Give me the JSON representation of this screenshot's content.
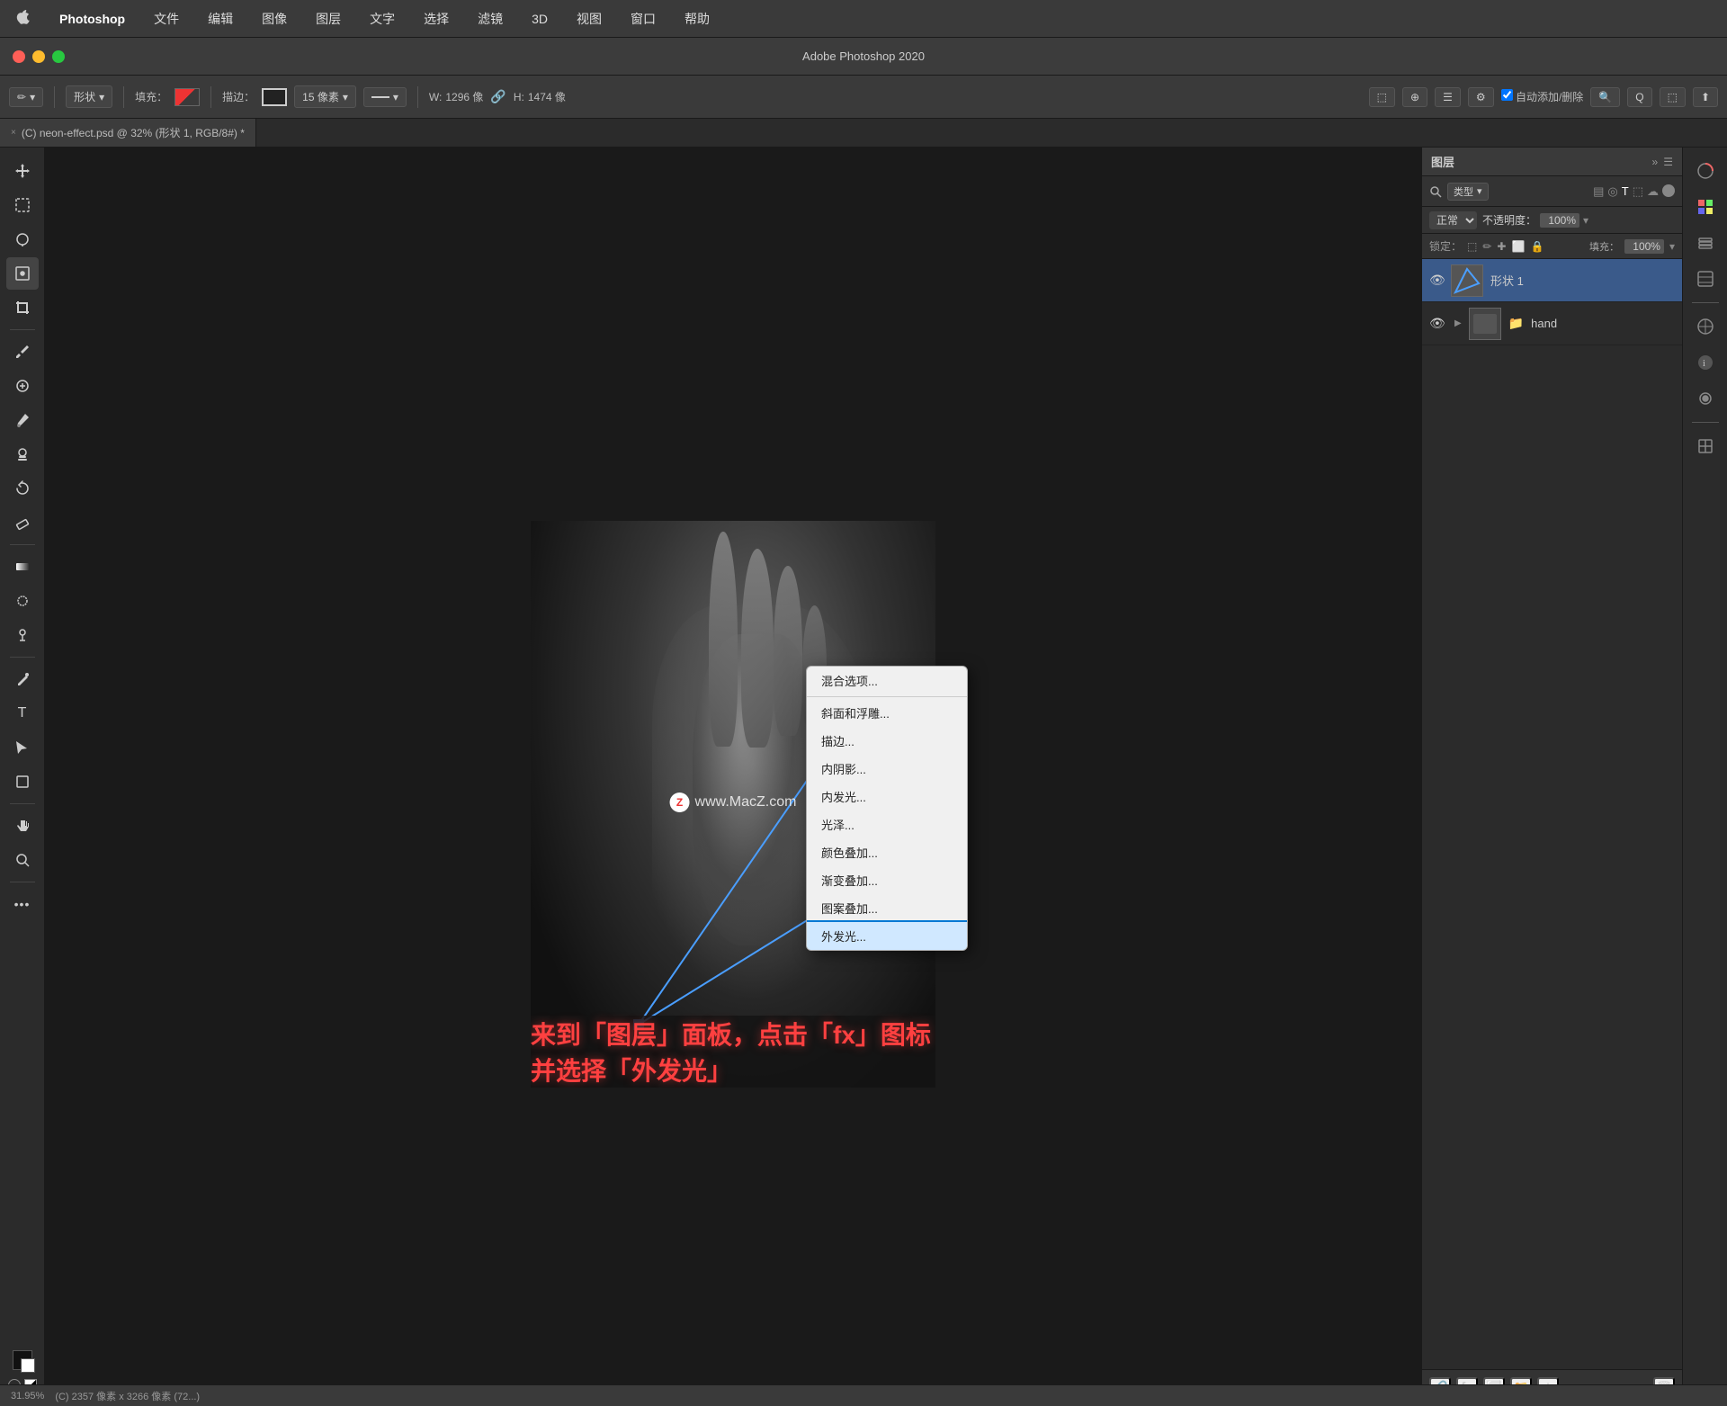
{
  "menubar": {
    "apple": "⌘",
    "items": [
      "Photoshop",
      "文件",
      "编辑",
      "图像",
      "图层",
      "文字",
      "选择",
      "滤镜",
      "3D",
      "视图",
      "窗口",
      "帮助"
    ]
  },
  "titlebar": {
    "title": "Adobe Photoshop 2020"
  },
  "toolbar": {
    "tool_icon": "✏",
    "shape_label": "形状",
    "fill_label": "填充：",
    "stroke_label": "描边：",
    "stroke_size": "15 像素",
    "width_label": "W:",
    "width_value": "1296 像",
    "height_label": "H:",
    "height_value": "1474 像",
    "auto_label": "自动添加/删除"
  },
  "tab": {
    "close": "×",
    "label": "(C) neon-effect.psd @ 32% (形状 1, RGB/8#) *"
  },
  "layers_panel": {
    "title": "图层",
    "filter_label": "类型",
    "blend_mode": "正常",
    "opacity_label": "不透明度：",
    "opacity_value": "100%",
    "fill_label": "填充：",
    "fill_value": "100%",
    "lock_label": "锁定：",
    "layers": [
      {
        "name": "形状 1",
        "type": "shape",
        "visible": true,
        "active": true
      },
      {
        "name": "hand",
        "type": "folder",
        "visible": true,
        "active": false
      }
    ],
    "expand_icon": "▶"
  },
  "context_menu": {
    "items": [
      {
        "label": "混合选项...",
        "highlighted": false,
        "sep_after": false
      },
      {
        "label": "斜面和浮雕...",
        "highlighted": false,
        "sep_after": false
      },
      {
        "label": "描边...",
        "highlighted": false,
        "sep_after": false
      },
      {
        "label": "内阴影...",
        "highlighted": false,
        "sep_after": false
      },
      {
        "label": "内发光...",
        "highlighted": false,
        "sep_after": false
      },
      {
        "label": "光泽...",
        "highlighted": false,
        "sep_after": false
      },
      {
        "label": "颜色叠加...",
        "highlighted": false,
        "sep_after": false
      },
      {
        "label": "渐变叠加...",
        "highlighted": false,
        "sep_after": false
      },
      {
        "label": "图案叠加...",
        "highlighted": false,
        "sep_after": false
      },
      {
        "label": "外发光...",
        "highlighted": true,
        "sep_after": false
      }
    ]
  },
  "watermark": {
    "logo": "Z",
    "text": "www.MacZ.com"
  },
  "caption": {
    "text": "来到「图层」面板，点击「fx」图标并选择「外发光」"
  },
  "statusbar": {
    "zoom": "31.95%",
    "info": "(C) 2357 像素 x 3266 像素 (72...)"
  },
  "tools": {
    "left": [
      "↔",
      "⬚",
      "○",
      "✱",
      "⊕",
      "✂",
      "✏",
      "⟖",
      "✐",
      "T",
      "↗",
      "⬜",
      "☞",
      "🔍",
      "•••"
    ],
    "colors": [
      "■",
      "□"
    ]
  },
  "far_right_icons": [
    "🎨",
    "⊞",
    "□",
    "⊟",
    "◯",
    "◕",
    "◓",
    "⟲"
  ]
}
